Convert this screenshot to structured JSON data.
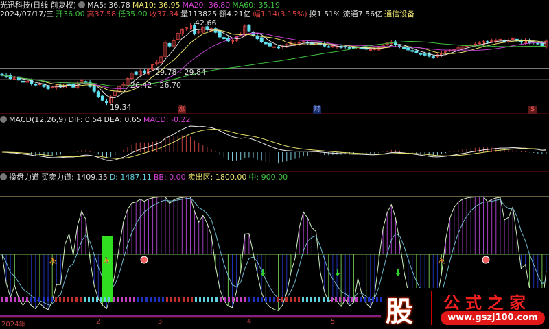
{
  "header": {
    "stock_name": "光迅科技(日线 前复权)",
    "ma5": "MA5: 36.78",
    "ma10": "MA10: 36.95",
    "ma20": "MA20: 36.80",
    "ma60": "MA60: 35.19",
    "date": "2024/07/17/三",
    "open": "开36.00",
    "high": "高37.58",
    "low": "低35.90",
    "close": "收37.34",
    "volume": "量113825",
    "amount": "额4.21亿",
    "change": "幅1.14(3.15%)",
    "turnover": "换1.51%",
    "float": "流通7.56亿",
    "sector": "通信设备"
  },
  "annotations": {
    "peak": "42.66",
    "trough": "19.34",
    "band1": "29.78 - 29.84",
    "band2": "26.42 - 26.70",
    "sig1": "涨",
    "sig2": "财",
    "sig3": "$"
  },
  "macd": {
    "title": "MACD(12,26,9)",
    "dif": "DIF: 0.54",
    "dea": "DEA: 0.65",
    "macd": "MACD: -0.22"
  },
  "indicator": {
    "title": "操盘力道",
    "mmld": "买卖力道: 1409.35",
    "d": "D: 1487.11",
    "bb": "BB: 0.00",
    "sell_zone": "卖出区: 1800.00",
    "mid": "中: 900.00"
  },
  "xaxis": [
    "2024年",
    "2",
    "3",
    "4",
    "5"
  ],
  "watermark": {
    "char": "股",
    "name": "公式之家",
    "url": "www.gszj100.com"
  },
  "colors": {
    "up": "#d04040",
    "down": "#60e0f0",
    "ma5": "#e0e0e0",
    "ma10": "#e8e06a",
    "ma20": "#c040d0",
    "ma60": "#40c040"
  },
  "chart_data": {
    "type": "candlestick",
    "title": "光迅科技 日线",
    "closes": [
      27.9,
      27.6,
      27.0,
      27.3,
      26.6,
      26.0,
      26.3,
      25.6,
      25.2,
      25.5,
      24.8,
      24.2,
      24.6,
      25.0,
      24.7,
      25.5,
      25.2,
      24.6,
      25.8,
      26.5,
      26.0,
      24.8,
      23.5,
      22.0,
      21.0,
      20.2,
      22.0,
      23.5,
      24.8,
      25.4,
      27.0,
      28.5,
      28.2,
      29.0,
      28.6,
      29.5,
      30.8,
      31.5,
      33.0,
      37.0,
      36.0,
      37.5,
      39.5,
      40.5,
      41.0,
      41.8,
      39.5,
      40.0,
      41.2,
      40.5,
      40.8,
      39.8,
      38.5,
      38.0,
      37.4,
      37.5,
      38.6,
      39.2,
      41.5,
      40.2,
      38.8,
      38.0,
      37.2,
      36.6,
      36.0,
      35.8,
      35.5,
      36.0,
      36.4,
      36.8,
      36.5,
      36.9,
      37.2,
      36.8,
      36.6,
      36.8,
      36.3,
      36.0,
      35.8,
      36.0,
      35.9,
      35.6,
      35.8,
      35.4,
      35.5,
      35.7,
      35.3,
      35.1,
      35.0,
      35.2,
      35.6,
      36.2,
      36.8,
      37.0,
      36.4,
      35.8,
      35.2,
      34.9,
      34.5,
      34.2,
      33.8,
      33.5,
      33.2,
      33.0,
      33.6,
      34.0,
      34.4,
      34.8,
      35.0,
      35.5,
      35.8,
      36.0,
      36.3,
      36.5,
      36.8,
      37.2,
      37.0,
      37.4,
      37.5,
      37.8,
      37.2,
      37.6,
      38.0,
      37.4,
      37.1,
      37.5,
      36.8,
      37.0,
      36.6,
      36.0,
      37.34
    ],
    "ylim": [
      19.34,
      42.66
    ],
    "hlines": [
      29.84,
      26.7
    ],
    "indicator_levels": [
      1800,
      900
    ]
  }
}
